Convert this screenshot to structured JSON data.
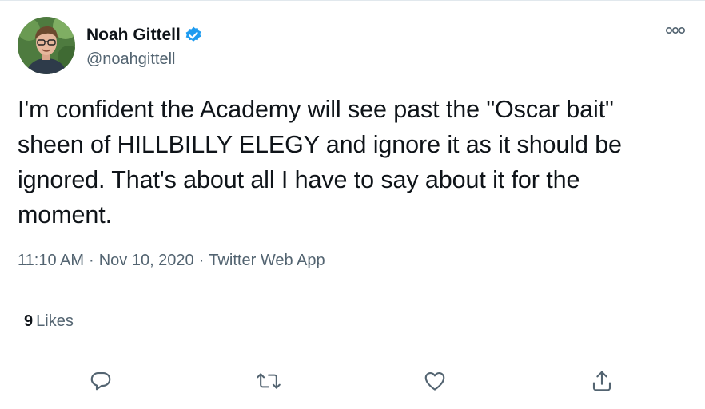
{
  "tweet": {
    "author": {
      "display_name": "Noah Gittell",
      "handle": "@noahgittell",
      "verified": true
    },
    "text": "I'm confident the Academy will see past the \"Oscar bait\"\nsheen of HILLBILLY ELEGY and ignore it as it should be\nignored. That's about all I have to say about it for the\nmoment.",
    "time": "11:10 AM",
    "date": "Nov 10, 2020",
    "source": "Twitter Web App",
    "separator": "·",
    "likes_count": "9",
    "likes_label": "Likes"
  },
  "icons": {
    "more": "more-horizontal-icon",
    "reply": "reply-icon",
    "retweet": "retweet-icon",
    "like": "heart-icon",
    "share": "share-icon",
    "verified": "verified-badge-icon"
  },
  "colors": {
    "text": "#0f1419",
    "secondary": "#536471",
    "verified": "#1d9bf0",
    "divider": "#e1e8ed"
  }
}
